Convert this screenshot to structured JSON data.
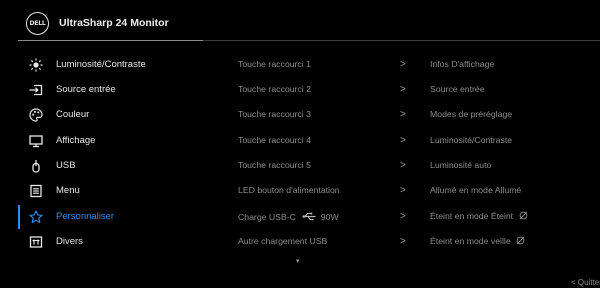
{
  "header": {
    "logo_text": "DELL",
    "title": "UltraSharp 24 Monitor"
  },
  "menu": {
    "items": [
      {
        "label": "Luminosité/Contraste",
        "icon": "brightness-icon"
      },
      {
        "label": "Source entrée",
        "icon": "input-source-icon"
      },
      {
        "label": "Couleur",
        "icon": "color-palette-icon"
      },
      {
        "label": "Affichage",
        "icon": "display-icon"
      },
      {
        "label": "USB",
        "icon": "usb-icon"
      },
      {
        "label": "Menu",
        "icon": "menu-icon"
      },
      {
        "label": "Personnaliser",
        "icon": "star-icon",
        "active": true
      },
      {
        "label": "Divers",
        "icon": "info-icon"
      }
    ]
  },
  "settings": {
    "rows": [
      {
        "label": "Touche raccourci 1",
        "value": "Infos D'affichage"
      },
      {
        "label": "Touche raccourci 2",
        "value": "Source entrée"
      },
      {
        "label": "Touche raccourci 3",
        "value": "Modes de préréglage"
      },
      {
        "label": "Touche raccourci 4",
        "value": "Luminosité/Contraste"
      },
      {
        "label": "Touche raccourci 5",
        "value": "Luminosité auto"
      },
      {
        "label": "LED bouton d'alimentation",
        "value": "Allumé en mode Allumé"
      },
      {
        "label": "Charge USB-C",
        "label_suffix": "90W",
        "value": "Éteint en mode Éteint"
      },
      {
        "label": "Autre chargement USB",
        "value": "Éteint en mode veille"
      }
    ],
    "arrow": ">",
    "more_indicator": "▾"
  },
  "footer": {
    "quit_label": "< Quitter"
  },
  "colors": {
    "accent": "#2f8ff0",
    "background": "#000000",
    "text": "#e6e6e6",
    "muted": "#8c8c8c"
  }
}
